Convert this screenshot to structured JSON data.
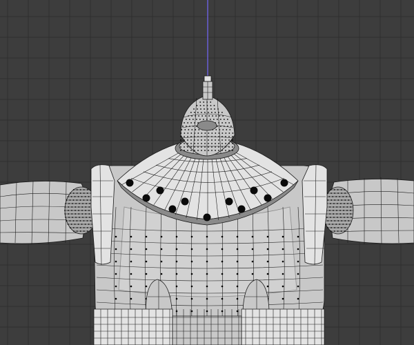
{
  "viewport": {
    "type": "3d-viewport",
    "background_color": "#3d3d3d",
    "grid_color": "#2f2f2f",
    "axis_color": "#6a5fd6",
    "mesh_color": "#c8c8c8",
    "wire_color": "#1a1a1a",
    "object": {
      "mode": "edit",
      "parts": [
        "antenna",
        "head",
        "collar",
        "torso",
        "left-shoulder",
        "right-shoulder",
        "left-arm",
        "right-arm",
        "left-leg",
        "right-leg",
        "belt"
      ]
    }
  }
}
